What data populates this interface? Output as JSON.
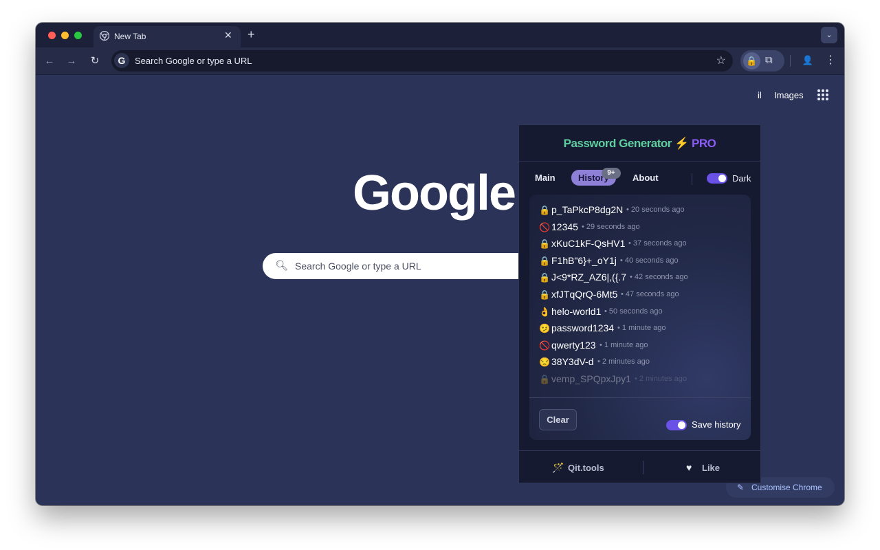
{
  "browser": {
    "tab": {
      "title": "New Tab",
      "close": "✕"
    },
    "new_tab": "+",
    "tab_search": "⌄",
    "omnibox": {
      "text": "Search Google or type a URL",
      "engine_badge": "G"
    },
    "traffic_lights": [
      "#ff5f57",
      "#febc2e",
      "#28c840"
    ]
  },
  "newtab_page": {
    "gmail_link": "il",
    "images_link": "Images",
    "logo": "Google",
    "search_placeholder": "Search Google or type a URL",
    "customise_label": "Customise Chrome"
  },
  "popup": {
    "title_main": "Password Generator",
    "title_bolt": "⚡",
    "title_pro": "PRO",
    "tabs": [
      {
        "label": "Main",
        "active": false
      },
      {
        "label": "History",
        "active": true
      },
      {
        "label": "About",
        "active": false
      }
    ],
    "history_badge": "9+",
    "dark_toggle": {
      "label": "Dark",
      "on": true
    },
    "history": [
      {
        "emoji": "🔒",
        "password": "p_TaPkcP8dg2N",
        "time": "20 seconds ago"
      },
      {
        "emoji": "🚫",
        "password": "12345",
        "time": "29 seconds ago"
      },
      {
        "emoji": "🔒",
        "password": "xKuC1kF-QsHV1",
        "time": "37 seconds ago"
      },
      {
        "emoji": "🔒",
        "password": "F1hB\"6}+_oY1j",
        "time": "40 seconds ago"
      },
      {
        "emoji": "🔒",
        "password": "J<9*RZ_AZ6|,({.7",
        "time": "42 seconds ago"
      },
      {
        "emoji": "🔒",
        "password": "xfJTqQrQ-6Mt5",
        "time": "47 seconds ago"
      },
      {
        "emoji": "👌",
        "password": "helo-world1",
        "time": "50 seconds ago"
      },
      {
        "emoji": "🫤",
        "password": "password1234",
        "time": "1 minute ago"
      },
      {
        "emoji": "🚫",
        "password": "qwerty123",
        "time": "1 minute ago"
      },
      {
        "emoji": "😒",
        "password": "38Y3dV-d",
        "time": "2 minutes ago"
      },
      {
        "emoji": "🔒",
        "password": "vemp_SPQpxJpy1",
        "time": "2 minutes ago"
      }
    ],
    "clear_label": "Clear",
    "save_history": {
      "label": "Save history",
      "on": true
    },
    "footer": {
      "qit_label": "Qit.tools",
      "like_label": "Like"
    }
  }
}
